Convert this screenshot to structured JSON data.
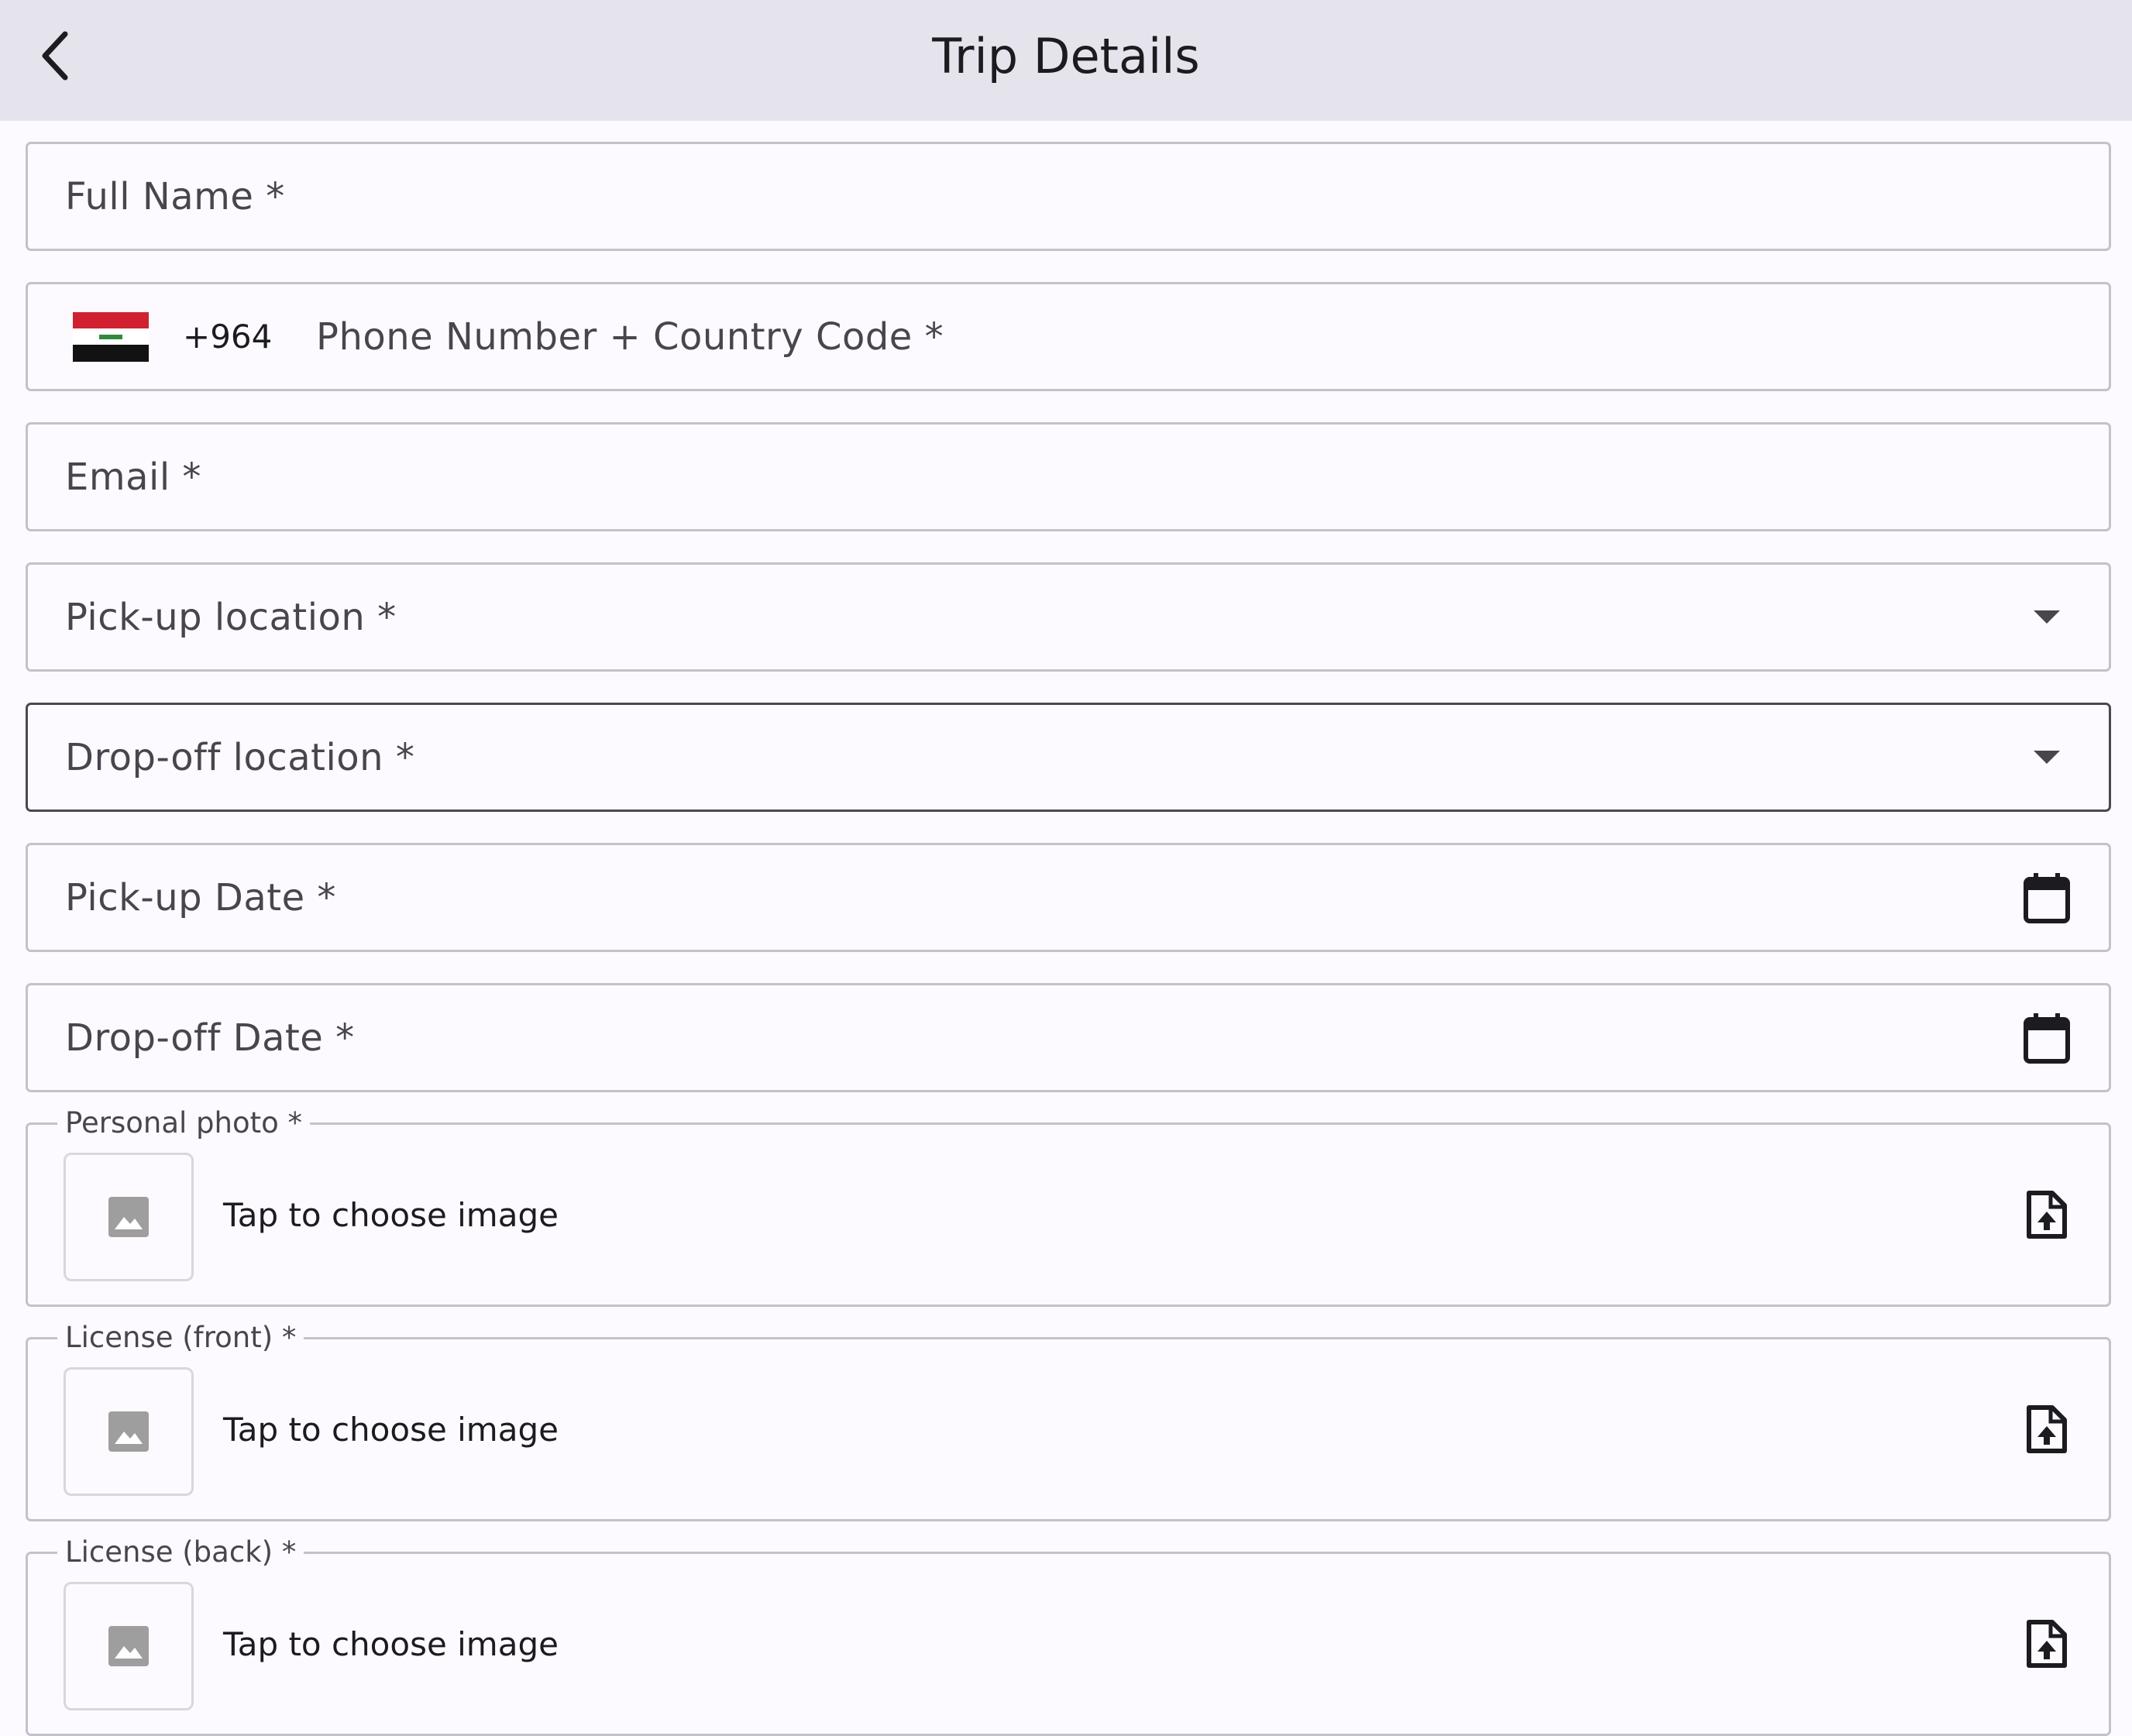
{
  "appbar": {
    "title": "Trip Details",
    "back_icon": "chevron-left-icon"
  },
  "form": {
    "full_name": {
      "label": "Full Name *",
      "value": ""
    },
    "phone": {
      "country_flag": "iraq-flag-icon",
      "country_code": "+964",
      "label": "Phone Number + Country Code *",
      "value": ""
    },
    "email": {
      "label": "Email *",
      "value": ""
    },
    "pickup_location": {
      "label": "Pick-up location *",
      "icon": "dropdown-arrow-icon"
    },
    "dropoff_location": {
      "label": "Drop-off location *",
      "icon": "dropdown-arrow-icon"
    },
    "pickup_date": {
      "label": "Pick-up Date *",
      "icon": "calendar-icon"
    },
    "dropoff_date": {
      "label": "Drop-off Date *",
      "icon": "calendar-icon"
    },
    "uploads": [
      {
        "legend": "Personal photo *",
        "action": "Tap to choose image",
        "thumb_icon": "image-placeholder-icon",
        "upload_icon": "file-upload-icon"
      },
      {
        "legend": "License (front) *",
        "action": "Tap to choose image",
        "thumb_icon": "image-placeholder-icon",
        "upload_icon": "file-upload-icon"
      },
      {
        "legend": "License (back) *",
        "action": "Tap to choose image",
        "thumb_icon": "image-placeholder-icon",
        "upload_icon": "file-upload-icon"
      }
    ]
  },
  "colors": {
    "appbar_bg": "#e5e4ec",
    "page_bg": "#fcfaff",
    "outline": "#c3c1c9",
    "focused_outline": "#4a4850",
    "text": "#1c1b1f",
    "label": "#49454f"
  }
}
